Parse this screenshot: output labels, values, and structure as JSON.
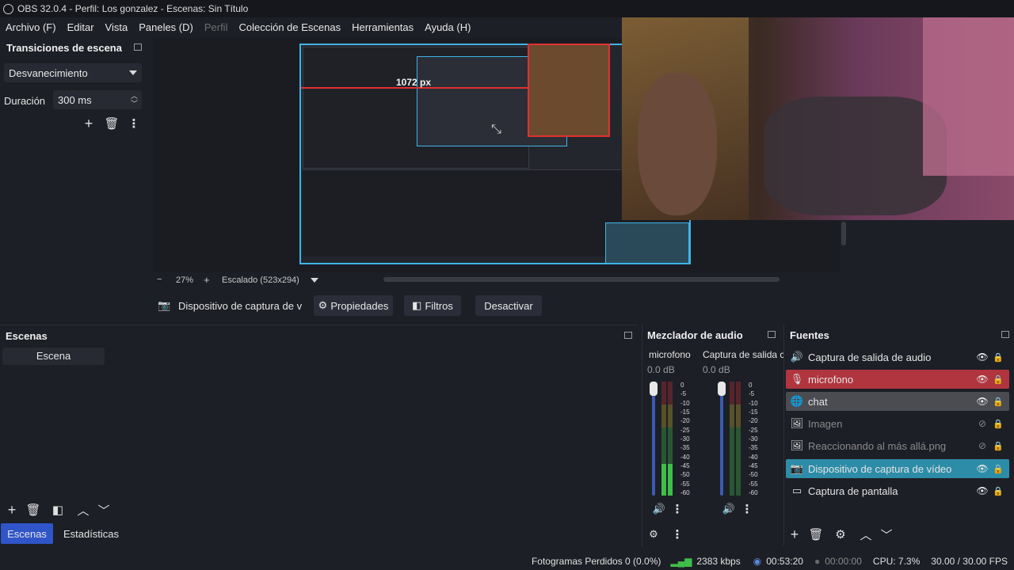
{
  "window": {
    "title": "OBS 32.0.4 - Perfil: Los gonzalez - Escenas: Sin Título"
  },
  "menu": [
    {
      "label": "Archivo (F)",
      "enabled": true
    },
    {
      "label": "Editar",
      "enabled": true
    },
    {
      "label": "Vista",
      "enabled": true
    },
    {
      "label": "Paneles (D)",
      "enabled": true
    },
    {
      "label": "Perfil",
      "enabled": false
    },
    {
      "label": "Colección de Escenas",
      "enabled": true
    },
    {
      "label": "Herramientas",
      "enabled": true
    },
    {
      "label": "Ayuda (H)",
      "enabled": true
    }
  ],
  "transitions": {
    "title": "Transiciones de escena",
    "selected": "Desvanecimiento",
    "duration_label": "Duración",
    "duration_value": "300 ms"
  },
  "preview": {
    "zoom": "27%",
    "minus": "−",
    "plus": "+",
    "scale_label": "Escalado (523x294)",
    "measure_label": "1072 px"
  },
  "source_toolbar": {
    "source_name": "Dispositivo de captura de v",
    "properties": "Propiedades",
    "filters": "Filtros",
    "deactivate": "Desactivar"
  },
  "scenes": {
    "title": "Escenas",
    "items": [
      "Escena"
    ],
    "tabs": [
      {
        "label": "Escenas",
        "active": true
      },
      {
        "label": "Estadísticas",
        "active": false
      }
    ]
  },
  "mixer": {
    "title": "Mezclador de audio",
    "channels": [
      {
        "name": "microfono",
        "db": "0.0 dB",
        "level": 0.28
      },
      {
        "name": "Captura de salida c",
        "db": "0.0 dB",
        "level": 0.0
      }
    ],
    "scale": [
      "0",
      "-5",
      "-10",
      "-15",
      "-20",
      "-25",
      "-30",
      "-35",
      "-40",
      "-45",
      "-50",
      "-55",
      "-60"
    ]
  },
  "sources": {
    "title": "Fuentes",
    "items": [
      {
        "label": "Captura de salida de audio",
        "icon": "speaker-icon",
        "visible": true,
        "style": "normal"
      },
      {
        "label": "microfono",
        "icon": "microphone-icon",
        "visible": true,
        "style": "red"
      },
      {
        "label": "chat",
        "icon": "globe-icon",
        "visible": true,
        "style": "gray"
      },
      {
        "label": "Imagen",
        "icon": "image-icon",
        "visible": false,
        "style": "dim"
      },
      {
        "label": "Reaccionando al más allá.png",
        "icon": "image-icon",
        "visible": false,
        "style": "dim"
      },
      {
        "label": "Dispositivo de captura de vídeo",
        "icon": "camera-icon",
        "visible": true,
        "style": "selected"
      },
      {
        "label": "Captura de pantalla",
        "icon": "monitor-icon",
        "visible": true,
        "style": "normal"
      }
    ]
  },
  "status": {
    "dropped": "Fotogramas Perdidos 0 (0.0%)",
    "bitrate": "2383 kbps",
    "stream_time": "00:53:20",
    "rec_time": "00:00:00",
    "cpu": "CPU: 7.3%",
    "fps": "30.00 / 30.00 FPS"
  },
  "colors": {
    "selected_source": "#2d8ca7",
    "mic_source": "#b0353f",
    "chat_source": "#4a4c52",
    "accent_tab": "#2f55c8",
    "preview_border": "#3fb4e6",
    "meter_green": "#3fbf4a",
    "meter_yellow": "#c7b12c",
    "meter_red": "#c92d3a"
  }
}
